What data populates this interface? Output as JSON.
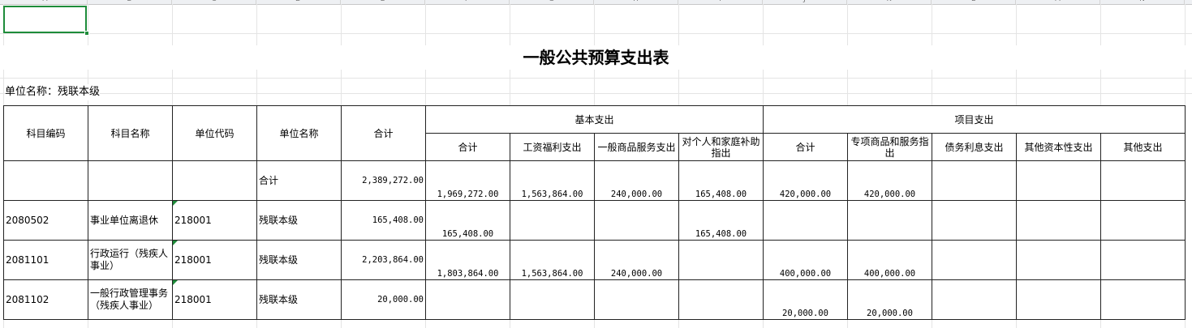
{
  "sheet": {
    "columns": [
      "A",
      "B",
      "C",
      "D",
      "E",
      "F",
      "G",
      "H",
      "I",
      "J",
      "K",
      "L",
      "M",
      "N"
    ]
  },
  "title": "一般公共预算支出表",
  "unit_label": "单位名称：残联本级",
  "table": {
    "headers": {
      "subject_code": "科目编码",
      "subject_name": "科目名称",
      "unit_code": "单位代码",
      "unit_name": "单位名称",
      "total": "合计",
      "basic": "基本支出",
      "project": "项目支出",
      "basic_total": "合计",
      "salary": "工资福利支出",
      "goods_services": "一般商品服务支出",
      "individual_subsidy": "对个人和家庭补助指出",
      "project_total": "合计",
      "special_goods": "专项商品和服务指出",
      "debt_interest": "债务利息支出",
      "other_capital": "其他资本性支出",
      "other": "其他支出"
    },
    "rows": [
      {
        "code": "",
        "name": "",
        "unit_code": "",
        "unit_name": "合计",
        "total": "2,389,272.00",
        "basic_total": "1,969,272.00",
        "salary": "1,563,864.00",
        "goods_services": "240,000.00",
        "individual_subsidy": "165,408.00",
        "project_total": "420,000.00",
        "special_goods": "420,000.00",
        "debt_interest": "",
        "other_capital": "",
        "other": ""
      },
      {
        "code": "2080502",
        "name": "事业单位离退休",
        "unit_code": "218001",
        "unit_name": "残联本级",
        "total": "165,408.00",
        "basic_total": "165,408.00",
        "salary": "",
        "goods_services": "",
        "individual_subsidy": "165,408.00",
        "project_total": "",
        "special_goods": "",
        "debt_interest": "",
        "other_capital": "",
        "other": ""
      },
      {
        "code": "2081101",
        "name": "行政运行（残疾人事业）",
        "unit_code": "218001",
        "unit_name": "残联本级",
        "total": "2,203,864.00",
        "basic_total": "1,803,864.00",
        "salary": "1,563,864.00",
        "goods_services": "240,000.00",
        "individual_subsidy": "",
        "project_total": "400,000.00",
        "special_goods": "400,000.00",
        "debt_interest": "",
        "other_capital": "",
        "other": ""
      },
      {
        "code": "2081102",
        "name": "一般行政管理事务（残疾人事业）",
        "unit_code": "218001",
        "unit_name": "残联本级",
        "total": "20,000.00",
        "basic_total": "",
        "salary": "",
        "goods_services": "",
        "individual_subsidy": "",
        "project_total": "20,000.00",
        "special_goods": "20,000.00",
        "debt_interest": "",
        "other_capital": "",
        "other": ""
      }
    ]
  },
  "colors": {
    "selection": "#1e8c3a",
    "grid": "#e4e4e4",
    "border": "#222222"
  }
}
